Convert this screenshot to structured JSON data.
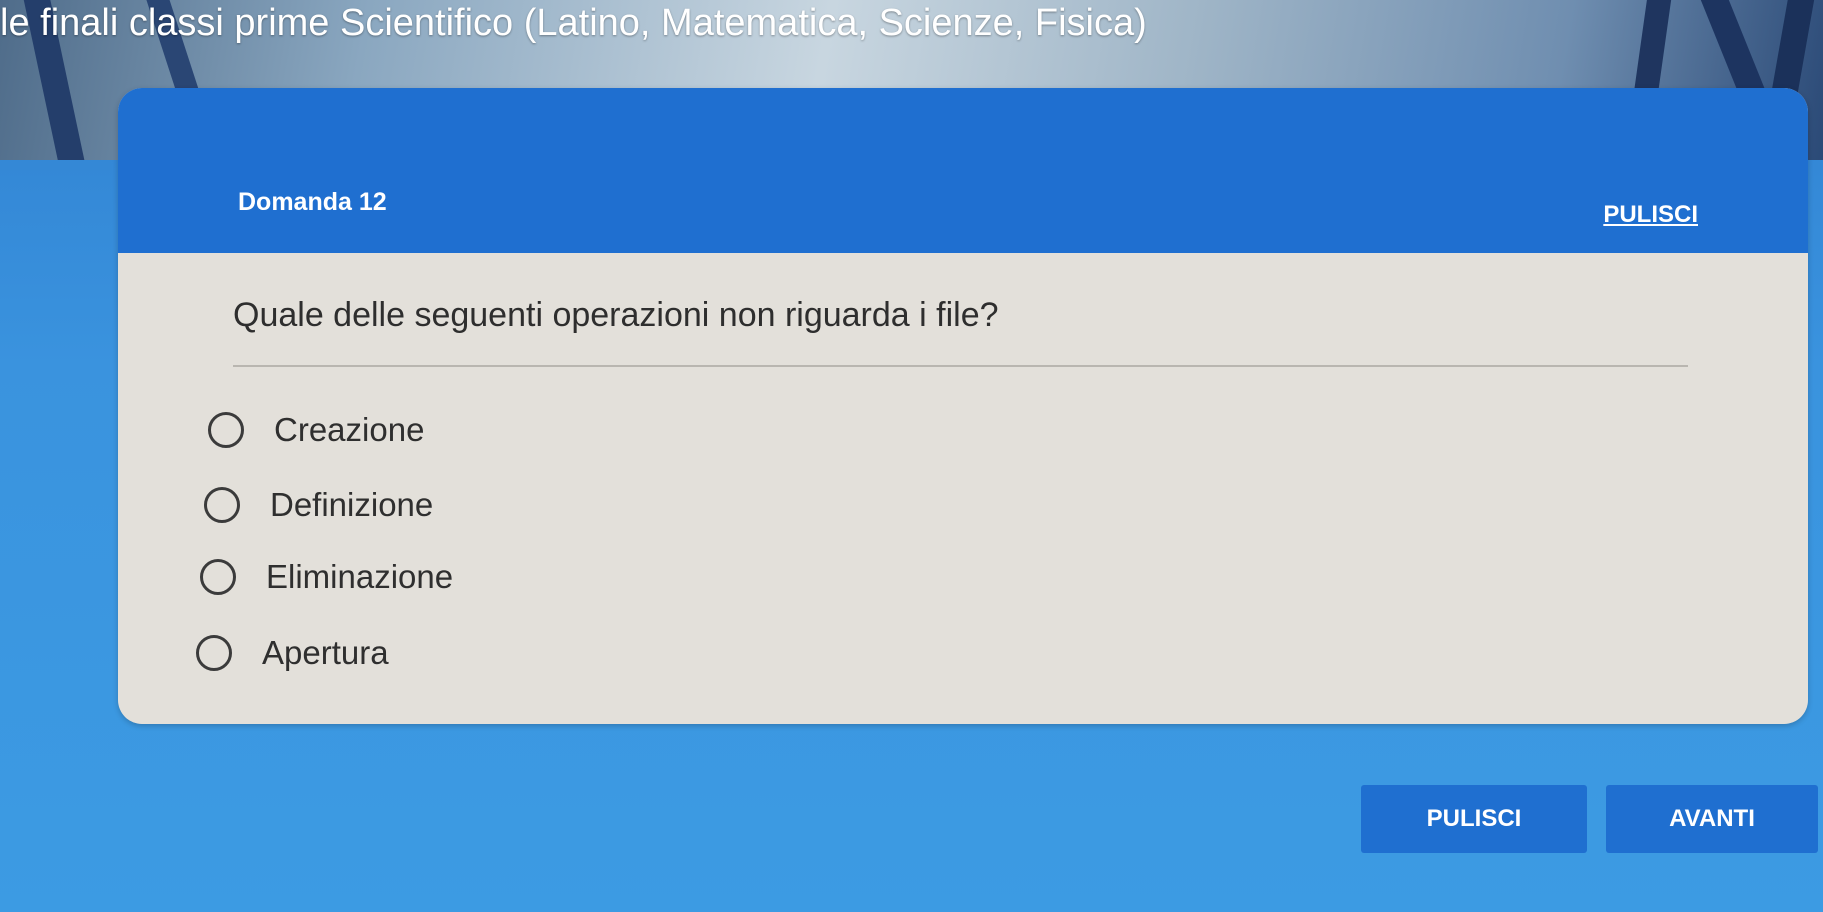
{
  "banner": {
    "title": "le finali classi prime Scientifico (Latino, Matematica, Scienze, Fisica)"
  },
  "quiz": {
    "question_number": "Domanda 12",
    "clear_link_label": "PULISCI",
    "question_text": "Quale delle seguenti operazioni non riguarda i file?",
    "options": [
      {
        "label": "Creazione",
        "selected": false
      },
      {
        "label": "Definizione",
        "selected": false
      },
      {
        "label": "Eliminazione",
        "selected": false
      },
      {
        "label": "Apertura",
        "selected": false
      }
    ]
  },
  "footer": {
    "clear_button_label": "PULISCI",
    "next_button_label": "AVANTI"
  },
  "colors": {
    "accent": "#1f6fd0",
    "card_background": "#e3e0da",
    "page_background": "#3a93de"
  }
}
